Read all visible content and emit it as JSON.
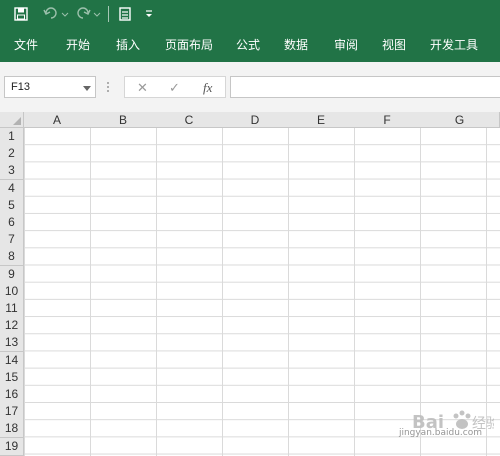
{
  "colors": {
    "ribbon": "#217346",
    "header_bg": "#e6e6e6",
    "gridline": "#dadada"
  },
  "qat": {
    "icons": [
      "save-icon",
      "undo-icon",
      "redo-icon",
      "customize-qat-icon"
    ]
  },
  "tabs": [
    "文件",
    "开始",
    "插入",
    "页面布局",
    "公式",
    "数据",
    "审阅",
    "视图",
    "开发工具"
  ],
  "formula_bar": {
    "name_box": "F13",
    "fx_label": "fx",
    "content": ""
  },
  "grid": {
    "columns": [
      "A",
      "B",
      "C",
      "D",
      "E",
      "F",
      "G"
    ],
    "rows": [
      "1",
      "2",
      "3",
      "4",
      "5",
      "6",
      "7",
      "8",
      "9",
      "10",
      "11",
      "12",
      "13",
      "14",
      "15",
      "16",
      "17",
      "18",
      "19"
    ]
  },
  "watermark": {
    "text": "Bai经验",
    "url": "jingyan.baidu.com"
  }
}
